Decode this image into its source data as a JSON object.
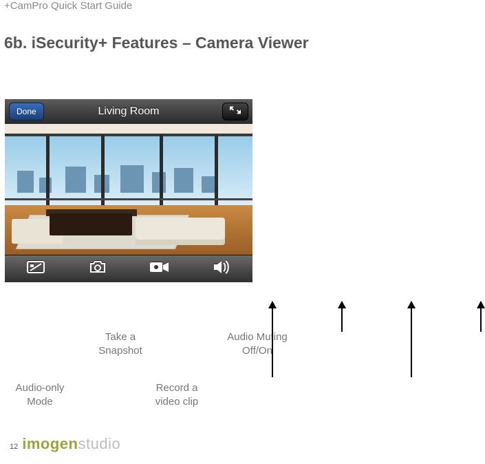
{
  "doc_header": "+CamPro Quick Start Guide",
  "section_title": "6b. iSecurity+ Features – Camera Viewer",
  "viewer": {
    "done_label": "Done",
    "camera_name": "Living Room"
  },
  "icons": {
    "expand": "fullscreen-collapse-icon",
    "audio_only": "screen-off-icon",
    "snapshot": "camera-icon",
    "record": "video-camera-icon",
    "audio_mute": "speaker-icon"
  },
  "callouts": {
    "audio_only": "Audio-only Mode",
    "snapshot": "Take a Snapshot",
    "record": "Record a video clip",
    "audio_mute": "Audio Muting Off/On"
  },
  "footer": {
    "page_number": "12",
    "brand_a": "imogen",
    "brand_b": "studio"
  }
}
